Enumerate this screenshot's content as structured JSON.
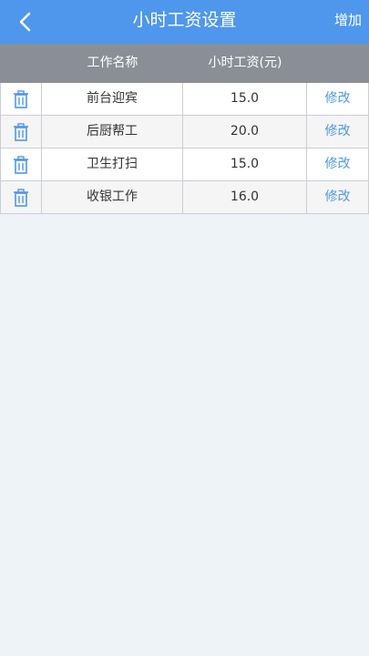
{
  "header": {
    "title": "小时工资设置",
    "back_icon": "chevron-left-icon",
    "add_label": "增加"
  },
  "table": {
    "columns": [
      "工作名称",
      "小时工资(元)"
    ],
    "rows": [
      {
        "name": "前台迎宾",
        "wage": "15.0",
        "edit_label": "修改"
      },
      {
        "name": "后厨帮工",
        "wage": "20.0",
        "edit_label": "修改"
      },
      {
        "name": "卫生打扫",
        "wage": "15.0",
        "edit_label": "修改"
      },
      {
        "name": "收银工作",
        "wage": "16.0",
        "edit_label": "修改"
      }
    ],
    "delete_icon": "trash-icon"
  },
  "colors": {
    "accent": "#4e97ec",
    "header_bar": "#8a8f97",
    "background": "#eef3f8"
  }
}
